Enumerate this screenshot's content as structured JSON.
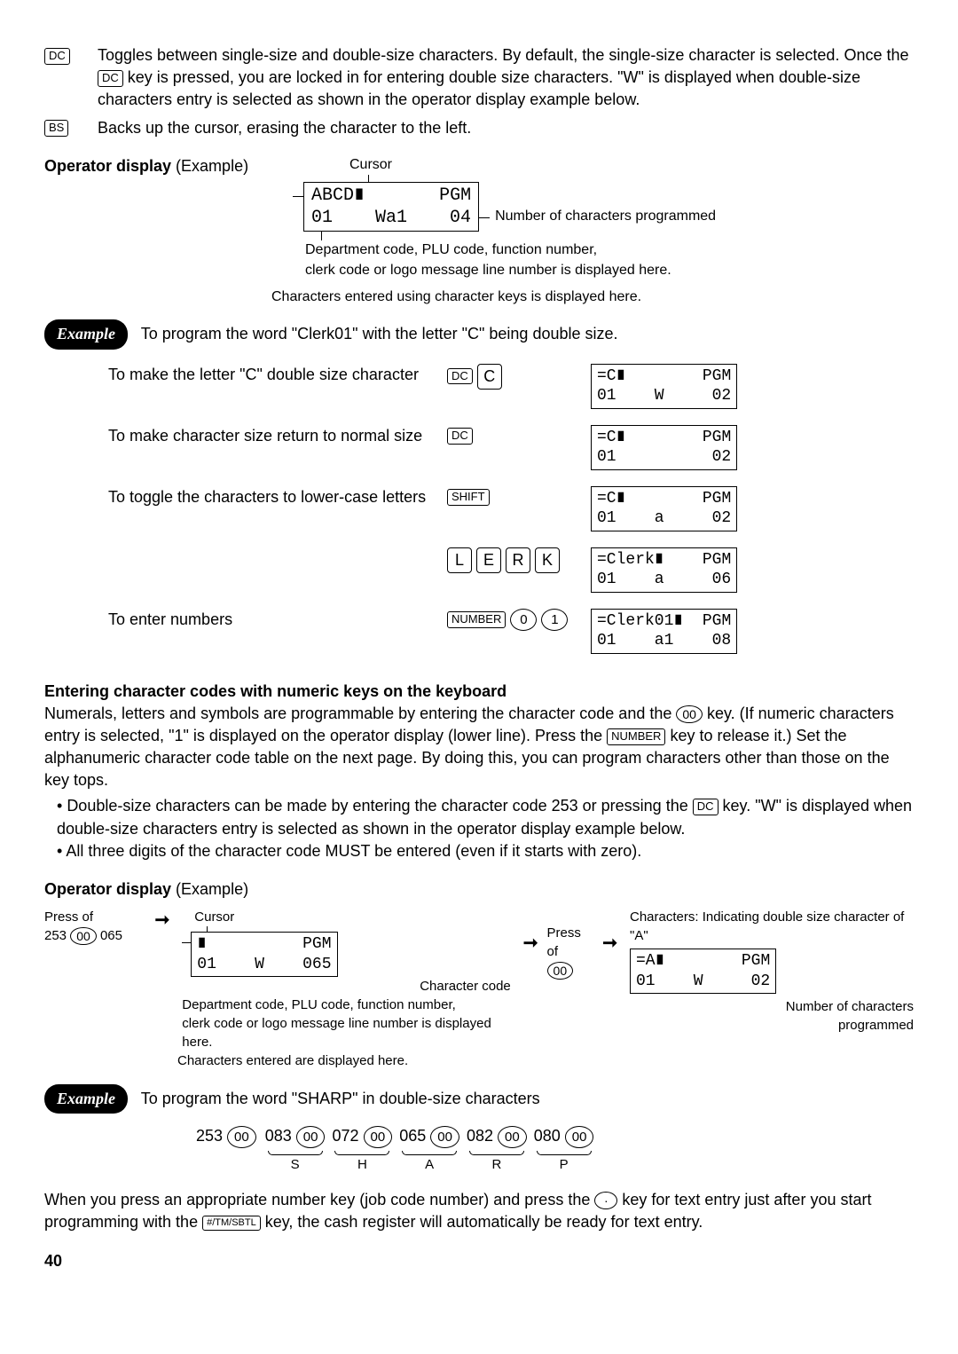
{
  "page_number": "40",
  "key_defs": [
    {
      "key": "DC",
      "text_parts": {
        "a": "Toggles between single-size and double-size characters.  By default, the single-size character is selected.  Once the ",
        "b": " key is pressed, you are locked in for entering double size characters.  \"W\"  is displayed when double-size characters entry is selected as shown in the operator display example below."
      }
    },
    {
      "key": "BS",
      "text": "Backs up the cursor, erasing the character to the left."
    }
  ],
  "operator_display_label_bold": "Operator display",
  "operator_display_label_rest": " (Example)",
  "display1": {
    "cursor_label": "Cursor",
    "line1": "ABCD∎       PGM",
    "line2": "01    Wa1    04",
    "right_label": "Number of characters programmed",
    "below1": "Department code, PLU code, function number,",
    "below2": "clerk code or logo message line number is displayed here.",
    "below3": "Characters entered using character keys is displayed here."
  },
  "example_label": "Example",
  "example1_text": "To program the word \"Clerk01\" with the letter \"C\" being double size.",
  "steps": [
    {
      "label": "To make the letter \"C\" double size character",
      "keys": [
        "DC",
        "C"
      ],
      "disp": "=C∎        PGM\n01    W     02"
    },
    {
      "label": "To make character size return to normal size",
      "keys": [
        "DC"
      ],
      "disp": "=C∎        PGM\n01          02"
    },
    {
      "label": "To toggle the characters to lower-case letters",
      "keys": [
        "SHIFT"
      ],
      "disp": "=C∎        PGM\n01    a     02"
    },
    {
      "label": "",
      "keys": [
        "L",
        "E",
        "R",
        "K"
      ],
      "disp": "=Clerk∎    PGM\n01    a     06"
    },
    {
      "label": "To enter numbers",
      "keys": [
        "NUMBER",
        "0",
        "1"
      ],
      "ovals": [
        false,
        true,
        true
      ],
      "disp": "=Clerk01∎  PGM\n01    a1    08"
    }
  ],
  "section2_heading": "Entering character codes with numeric keys on the keyboard",
  "section2_para_a": "Numerals, letters and symbols are programmable by entering the character code and the ",
  "section2_para_b": " key.  (If numeric characters entry is selected, \"1\" is displayed on the operator display (lower line).  Press the ",
  "section2_para_c": " key to release it.)  Set the alphanumeric character code table on the next page.  By doing this, you can program characters other than those on the key tops.",
  "bullet1_a": "Double-size characters can be made by entering the character code 253 or pressing the ",
  "bullet1_b": " key.  \"W\" is displayed when double-size characters entry is selected as shown in the operator display example below.",
  "bullet2": "All three digits of the character code MUST be entered (even if it starts with zero).",
  "display2": {
    "cursor_label": "Cursor",
    "press_of": "Press of",
    "press_seq_a": "253 ",
    "press_seq_b": " 065",
    "line1_a": "∎          PGM",
    "line2_a": "01    W    065",
    "char_code_label": "Character code",
    "press_of_2": "Press of",
    "right_title": "Characters: Indicating double size character of \"A\"",
    "line1_b": "=A∎        PGM",
    "line2_b": "01    W     02",
    "num_label1": "Number of characters",
    "num_label2": "programmed",
    "below1": "Department code, PLU code, function number,",
    "below2": "clerk code or logo message line number is displayed here.",
    "below3": "Characters entered are displayed here."
  },
  "example2_text": "To program the word \"SHARP\" in double-size characters",
  "sharp_seq": {
    "prefix": "253 ",
    "pairs": [
      {
        "code": "083",
        "letter": "S"
      },
      {
        "code": "072",
        "letter": "H"
      },
      {
        "code": "065",
        "letter": "A"
      },
      {
        "code": "082",
        "letter": "R"
      },
      {
        "code": "080",
        "letter": "P"
      }
    ]
  },
  "final_para_a": "When you press an appropriate number key (job code number) and press the ",
  "final_para_b": " key for text entry just after you start programming with the ",
  "final_para_c": " key, the cash register will automatically be ready for text entry.",
  "key_oval_00": "00",
  "key_number": "NUMBER",
  "key_dc": "DC",
  "key_dot": "·",
  "key_tmsbtl": "#/TM/SBTL"
}
